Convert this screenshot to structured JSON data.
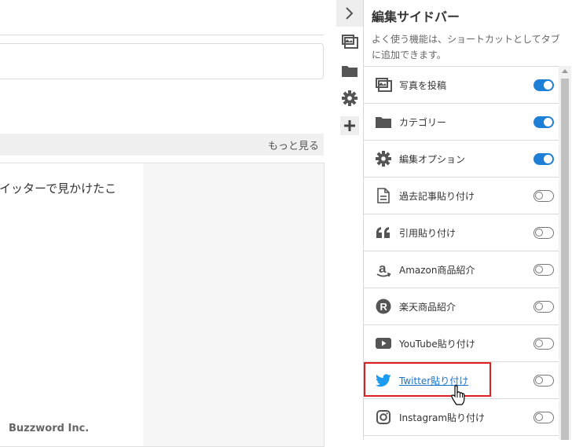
{
  "editor": {
    "more_link": "もっと見る",
    "post_text": "イッターで見かけたこ"
  },
  "watermark": "Buzzword Inc.",
  "sidebar": {
    "title": "編集サイドバー",
    "description": "よく使う機能は、ショートカットとしてタブに追加できます。",
    "items": [
      {
        "label": "写真を投稿",
        "icon": "photo-icon",
        "enabled": true
      },
      {
        "label": "カテゴリー",
        "icon": "folder-icon",
        "enabled": true
      },
      {
        "label": "編集オプション",
        "icon": "gear-icon",
        "enabled": true
      },
      {
        "label": "過去記事貼り付け",
        "icon": "document-icon",
        "enabled": false
      },
      {
        "label": "引用貼り付け",
        "icon": "quote-icon",
        "enabled": false
      },
      {
        "label": "Amazon商品紹介",
        "icon": "amazon-icon",
        "enabled": false
      },
      {
        "label": "楽天商品紹介",
        "icon": "rakuten-icon",
        "enabled": false
      },
      {
        "label": "YouTube貼り付け",
        "icon": "youtube-icon",
        "enabled": false
      },
      {
        "label": "Twitter貼り付け",
        "icon": "twitter-icon",
        "enabled": false
      },
      {
        "label": "Instagram貼り付け",
        "icon": "instagram-icon",
        "enabled": false
      }
    ]
  },
  "colors": {
    "toggle_on": "#1e7fd6",
    "twitter": "#1d9bf0",
    "highlight": "#e02020",
    "link": "#1a73c8"
  }
}
